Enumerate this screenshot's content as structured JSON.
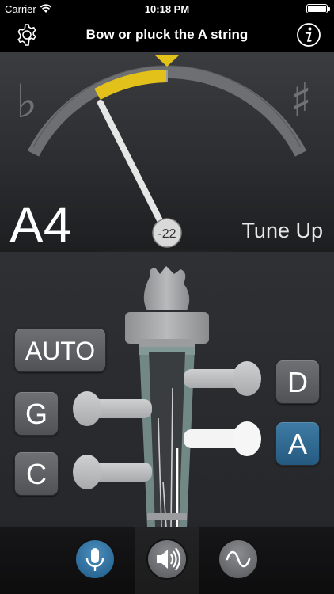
{
  "status_bar": {
    "carrier": "Carrier",
    "time": "10:18 PM",
    "battery_percent": 100
  },
  "nav": {
    "title": "Bow or pluck the A string",
    "left_icon": "gear-icon",
    "right_icon": "info-icon"
  },
  "meter": {
    "flat_symbol": "♭",
    "sharp_symbol": "♯",
    "note": "A4",
    "cents": "-22",
    "instruction": "Tune Up",
    "accent_color": "#e2c21a",
    "needle_color": "#e6e6e6"
  },
  "strings": {
    "auto_label": "AUTO",
    "g_label": "G",
    "c_label": "C",
    "d_label": "D",
    "a_label": "A",
    "selected": "A",
    "selected_color": "#2f6d97"
  },
  "tabs": {
    "mic_icon": "microphone-icon",
    "speaker_icon": "speaker-icon",
    "wave_icon": "sine-wave-icon"
  }
}
